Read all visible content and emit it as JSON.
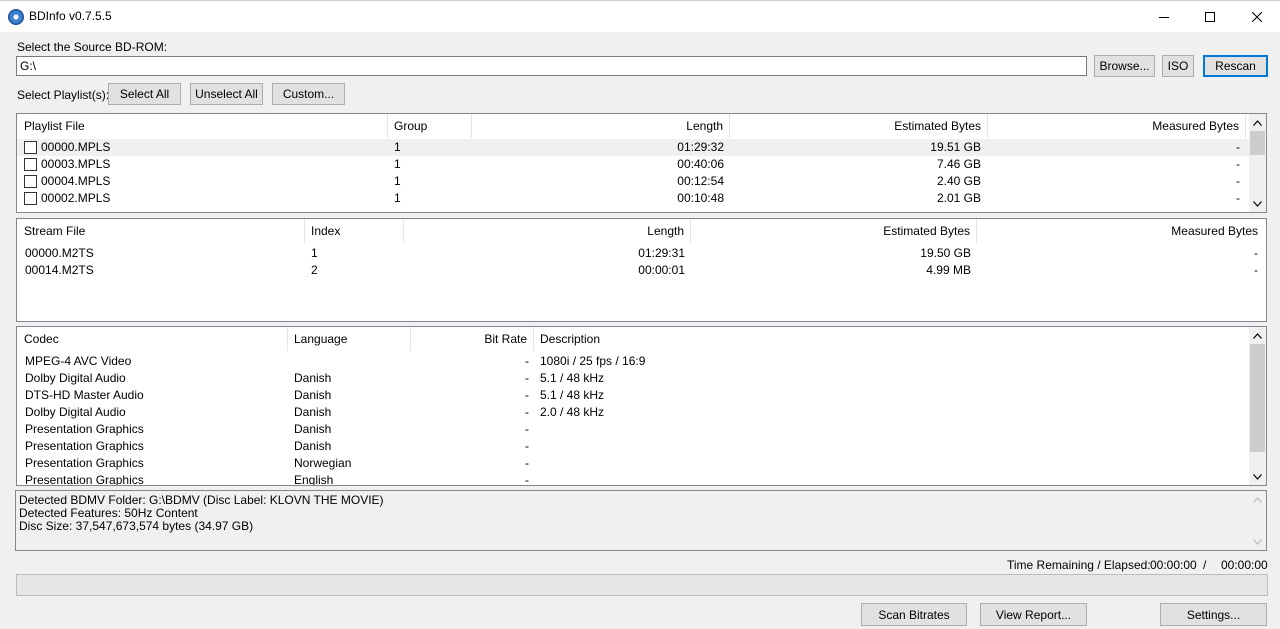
{
  "window": {
    "title": "BDInfo v0.7.5.5"
  },
  "source": {
    "label": "Select the Source BD-ROM:",
    "value": "G:\\",
    "browse_label": "Browse...",
    "iso_label": "ISO",
    "rescan_label": "Rescan"
  },
  "playlist_select": {
    "label": "Select Playlist(s):",
    "select_all_label": "Select All",
    "unselect_all_label": "Unselect All",
    "custom_label": "Custom..."
  },
  "playlists": {
    "headers": [
      "Playlist File",
      "Group",
      "Length",
      "Estimated Bytes",
      "Measured Bytes"
    ],
    "rows": [
      [
        "00000.MPLS",
        "1",
        "01:29:32",
        "19.51 GB",
        "-"
      ],
      [
        "00003.MPLS",
        "1",
        "00:40:06",
        "7.46 GB",
        "-"
      ],
      [
        "00004.MPLS",
        "1",
        "00:12:54",
        "2.40 GB",
        "-"
      ],
      [
        "00002.MPLS",
        "1",
        "00:10:48",
        "2.01 GB",
        "-"
      ]
    ]
  },
  "streams": {
    "headers": [
      "Stream File",
      "Index",
      "Length",
      "Estimated Bytes",
      "Measured Bytes"
    ],
    "rows": [
      [
        "00000.M2TS",
        "1",
        "01:29:31",
        "19.50 GB",
        "-"
      ],
      [
        "00014.M2TS",
        "2",
        "00:00:01",
        "4.99 MB",
        "-"
      ]
    ]
  },
  "codecs": {
    "headers": [
      "Codec",
      "Language",
      "Bit Rate",
      "Description"
    ],
    "rows": [
      [
        "MPEG-4 AVC Video",
        "",
        "-",
        "1080i / 25 fps / 16:9"
      ],
      [
        "Dolby Digital Audio",
        "Danish",
        "-",
        "5.1 / 48 kHz"
      ],
      [
        "DTS-HD Master Audio",
        "Danish",
        "-",
        "5.1 / 48 kHz"
      ],
      [
        "Dolby Digital Audio",
        "Danish",
        "-",
        "2.0 / 48 kHz"
      ],
      [
        "Presentation Graphics",
        "Danish",
        "-",
        ""
      ],
      [
        "Presentation Graphics",
        "Danish",
        "-",
        ""
      ],
      [
        "Presentation Graphics",
        "Norwegian",
        "-",
        ""
      ],
      [
        "Presentation Graphics",
        "English",
        "-",
        ""
      ]
    ]
  },
  "log": [
    "Detected BDMV Folder: G:\\BDMV (Disc Label: KLOVN THE MOVIE)",
    "Detected Features: 50Hz Content",
    "Disc Size: 37,547,673,574 bytes (34.97 GB)"
  ],
  "status": {
    "time_label": "Time Remaining / Elapsed:",
    "remaining": "00:00:00",
    "separator": "/",
    "elapsed": "00:00:00"
  },
  "bottom_buttons": {
    "scan_label": "Scan Bitrates",
    "report_label": "View Report...",
    "settings_label": "Settings..."
  },
  "colors": {
    "selected_row": "#f0f0f0",
    "accent": "#0078d7"
  }
}
